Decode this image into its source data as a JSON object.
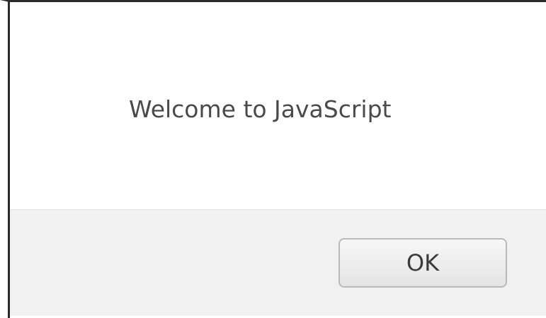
{
  "dialog": {
    "message": "Welcome to JavaScript",
    "ok_label": "OK"
  }
}
